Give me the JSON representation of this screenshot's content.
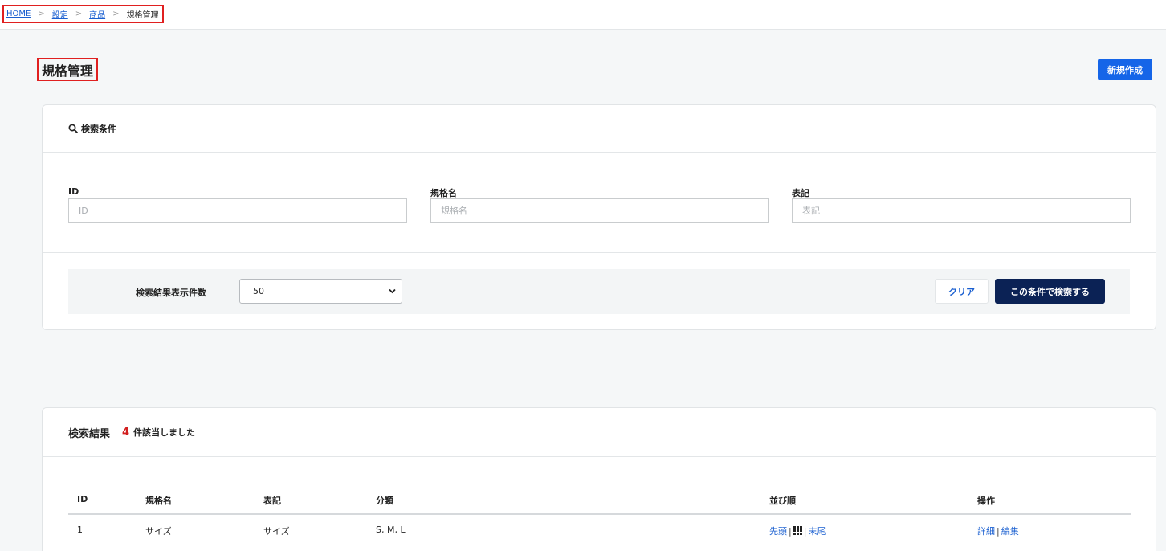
{
  "breadcrumb": {
    "items": [
      "HOME",
      "設定",
      "商品"
    ],
    "separator": ">",
    "current": "規格管理"
  },
  "page": {
    "title": "規格管理",
    "new_button": "新規作成"
  },
  "search": {
    "header": "検索条件",
    "fields": [
      {
        "label": "ID",
        "placeholder": "ID",
        "value": ""
      },
      {
        "label": "規格名",
        "placeholder": "規格名",
        "value": ""
      },
      {
        "label": "表記",
        "placeholder": "表記",
        "value": ""
      }
    ],
    "per_page_label": "検索結果表示件数",
    "per_page_value": "50",
    "clear_button": "クリア",
    "submit_button": "この条件で検索する"
  },
  "results": {
    "title": "検索結果",
    "count": "4",
    "count_suffix": "件該当しました",
    "columns": [
      "ID",
      "規格名",
      "表記",
      "分類",
      "並び順",
      "操作"
    ],
    "rows": [
      {
        "id": "1",
        "name": "サイズ",
        "notation": "サイズ",
        "category": "S, M, L",
        "order_first": "先頭",
        "order_last": "末尾",
        "action_detail": "詳細",
        "action_edit": "編集"
      }
    ]
  },
  "colors": {
    "primary": "#1565e8",
    "dark_navy": "#0b2255",
    "highlight_red": "#e02020",
    "count_red": "#d21f1f",
    "link": "#1a5fd0"
  }
}
